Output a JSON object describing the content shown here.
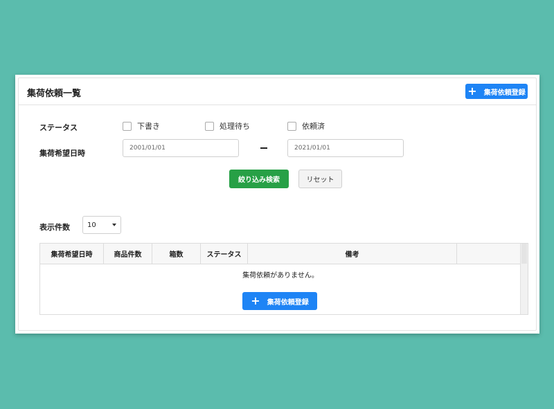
{
  "header": {
    "title": "集荷依頼一覧",
    "add_button": {
      "icon": "plus-icon",
      "label": "集荷依頼登録"
    }
  },
  "filters": {
    "status_label": "ステータス",
    "status_options": [
      {
        "label": "下書き",
        "checked": false
      },
      {
        "label": "処理待ち",
        "checked": false
      },
      {
        "label": "依頼済",
        "checked": false
      }
    ],
    "date_label": "集荷希望日時",
    "date_from": "2001/01/01",
    "date_to": "2021/01/01",
    "search_button": "絞り込み検索",
    "reset_button": "リセット"
  },
  "pagination": {
    "page_size_label": "表示件数",
    "page_size_value": "10"
  },
  "table": {
    "columns": [
      "集荷希望日時",
      "商品件数",
      "箱数",
      "ステータス",
      "備考",
      ""
    ],
    "empty_message": "集荷依頼がありません。",
    "add_button": {
      "icon": "plus-icon",
      "label": "集荷依頼登録"
    }
  },
  "colors": {
    "background": "#5bbcad",
    "primary": "#1e84f5",
    "success": "#27a046"
  }
}
